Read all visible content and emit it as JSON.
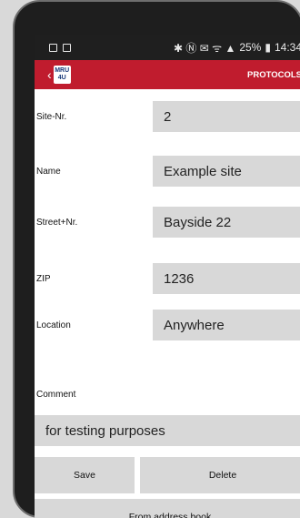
{
  "statusbar": {
    "icons_right": "✱ Ⓝ ✉ ᯤ ▲",
    "battery": "25%",
    "time": "14:34"
  },
  "appbar": {
    "logo_line1": "MRU",
    "logo_line2": "4U",
    "protocols": "PROTOCOLS"
  },
  "form": {
    "site_nr": {
      "label": "Site-Nr.",
      "value": "2"
    },
    "name": {
      "label": "Name",
      "value": "Example site"
    },
    "street": {
      "label": "Street+Nr.",
      "value": "Bayside 22"
    },
    "zip": {
      "label": "ZIP",
      "value": "1236"
    },
    "location": {
      "label": "Location",
      "value": "Anywhere"
    },
    "comment": {
      "label": "Comment",
      "value": "for testing purposes"
    }
  },
  "buttons": {
    "save": "Save",
    "delete": "Delete",
    "address_book": "From address book"
  },
  "colors": {
    "appbar": "#c01c2e",
    "field_bg": "#d8d8d8"
  },
  "icons": [
    "back-chevron-icon",
    "app-logo",
    "bluetooth-icon",
    "nfc-icon",
    "mute-icon",
    "wifi-icon",
    "signal-icon",
    "battery-icon"
  ]
}
